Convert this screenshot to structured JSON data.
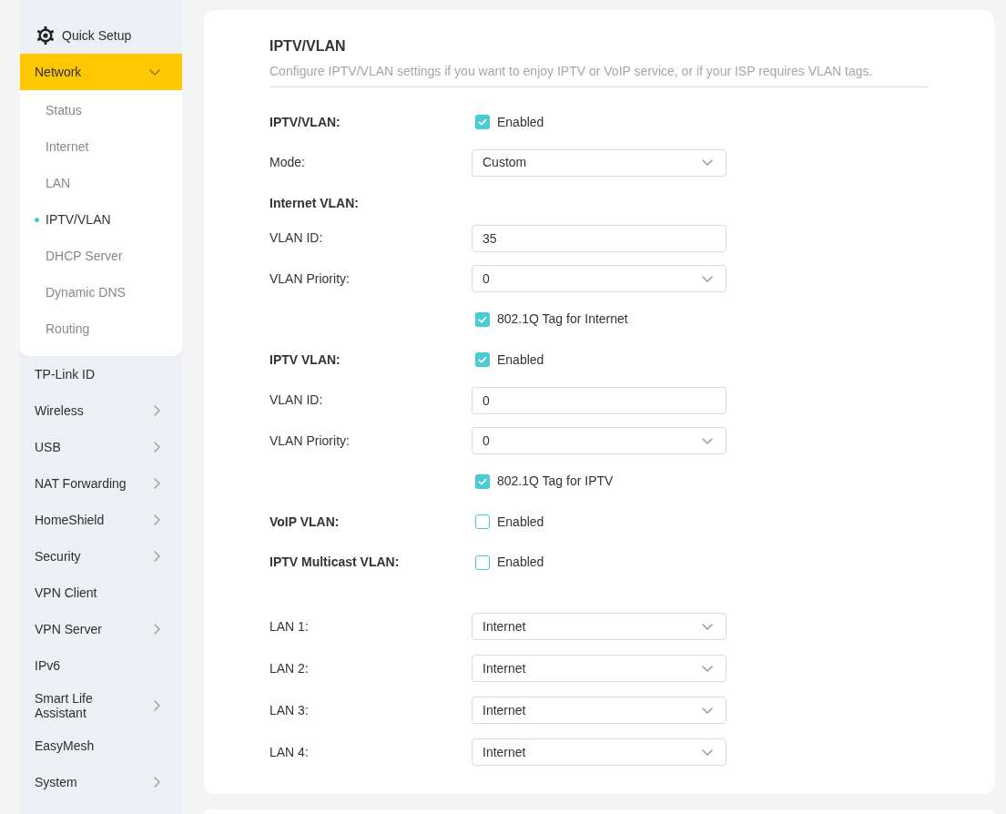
{
  "sidebar": {
    "items": [
      {
        "label": "Quick Setup",
        "kind": "shortcut",
        "selected": false
      },
      {
        "label": "Network",
        "kind": "group",
        "selected": true,
        "expanded": true,
        "children": [
          {
            "label": "Status",
            "selected": false
          },
          {
            "label": "Internet",
            "selected": false
          },
          {
            "label": "LAN",
            "selected": false
          },
          {
            "label": "IPTV/VLAN",
            "selected": true
          },
          {
            "label": "DHCP Server",
            "selected": false
          },
          {
            "label": "Dynamic DNS",
            "selected": false
          },
          {
            "label": "Routing",
            "selected": false
          }
        ]
      },
      {
        "label": "TP-Link ID",
        "kind": "link",
        "selected": false
      },
      {
        "label": "Wireless",
        "kind": "group",
        "selected": false,
        "expanded": false
      },
      {
        "label": "USB",
        "kind": "group",
        "selected": false,
        "expanded": false
      },
      {
        "label": "NAT Forwarding",
        "kind": "group",
        "selected": false,
        "expanded": false
      },
      {
        "label": "HomeShield",
        "kind": "group",
        "selected": false,
        "expanded": false
      },
      {
        "label": "Security",
        "kind": "group",
        "selected": false,
        "expanded": false
      },
      {
        "label": "VPN Client",
        "kind": "link",
        "selected": false
      },
      {
        "label": "VPN Server",
        "kind": "group",
        "selected": false,
        "expanded": false
      },
      {
        "label": "IPv6",
        "kind": "link",
        "selected": false
      },
      {
        "label": "Smart Life Assistant",
        "kind": "group",
        "selected": false,
        "expanded": false
      },
      {
        "label": "EasyMesh",
        "kind": "link",
        "selected": false
      },
      {
        "label": "System",
        "kind": "group",
        "selected": false,
        "expanded": false
      }
    ]
  },
  "form": {
    "title": "IPTV/VLAN",
    "description": "Configure IPTV/VLAN settings if you want to enjoy IPTV or VoIP service, or if your ISP requires VLAN tags.",
    "rows": [
      {
        "kind": "section",
        "label": "IPTV/VLAN:",
        "option": "Enabled",
        "checked": true
      },
      {
        "kind": "select",
        "label": "Mode:",
        "value": "Custom"
      },
      {
        "kind": "section",
        "label": "Internet VLAN:"
      },
      {
        "kind": "input",
        "label": "VLAN ID:",
        "value": "35"
      },
      {
        "kind": "select",
        "label": "VLAN Priority:",
        "value": "0"
      },
      {
        "kind": "checkbox",
        "option": "802.1Q Tag for Internet",
        "checked": true
      },
      {
        "kind": "section",
        "label": "IPTV VLAN:",
        "option": "Enabled",
        "checked": true
      },
      {
        "kind": "input",
        "label": "VLAN ID:",
        "value": "0"
      },
      {
        "kind": "select",
        "label": "VLAN Priority:",
        "value": "0"
      },
      {
        "kind": "checkbox",
        "option": "802.1Q Tag for IPTV",
        "checked": true
      },
      {
        "kind": "section",
        "label": "VoIP VLAN:",
        "option": "Enabled",
        "checked": false
      },
      {
        "kind": "section",
        "label": "IPTV Multicast VLAN:",
        "option": "Enabled",
        "checked": false
      }
    ],
    "ports": [
      {
        "label": "LAN 1:",
        "value": "Internet"
      },
      {
        "label": "LAN 2:",
        "value": "Internet"
      },
      {
        "label": "LAN 3:",
        "value": "Internet"
      },
      {
        "label": "LAN 4:",
        "value": "Internet"
      }
    ]
  }
}
